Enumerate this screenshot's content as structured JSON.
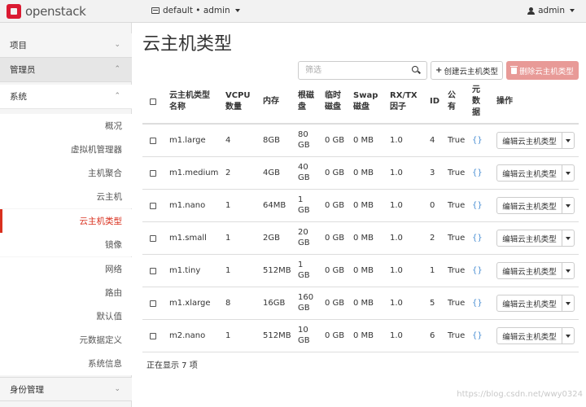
{
  "topbar": {
    "brand": "openstack",
    "project": "default • admin",
    "user": "admin"
  },
  "sidebar": {
    "sections": [
      {
        "label": "项目",
        "chevron": "⌄"
      },
      {
        "label": "管理员",
        "chevron": "⌃"
      }
    ],
    "system_label": "系统",
    "system_chevron": "⌃",
    "items": [
      {
        "label": "概况"
      },
      {
        "label": "虚拟机管理器"
      },
      {
        "label": "主机聚合"
      },
      {
        "label": "云主机"
      },
      {
        "label": "云主机类型"
      },
      {
        "label": "镜像"
      },
      {
        "label": "网络"
      },
      {
        "label": "路由"
      },
      {
        "label": "默认值"
      },
      {
        "label": "元数据定义"
      },
      {
        "label": "系统信息"
      }
    ],
    "identity_label": "身份管理",
    "identity_chevron": "⌄"
  },
  "main": {
    "title": "云主机类型",
    "filter_placeholder": "筛选",
    "create_label": "创建云主机类型",
    "delete_label": "删除云主机类型",
    "columns": {
      "name_l1": "云主机类型",
      "name_l2": "名称",
      "vcpu_l1": "VCPU",
      "vcpu_l2": "数量",
      "ram": "内存",
      "root_l1": "根磁",
      "root_l2": "盘",
      "eph_l1": "临时",
      "eph_l2": "磁盘",
      "swap_l1": "Swap",
      "swap_l2": "磁盘",
      "rxtx_l1": "RX/TX",
      "rxtx_l2": "因子",
      "id": "ID",
      "public_l1": "公",
      "public_l2": "有",
      "meta_l1": "元",
      "meta_l2": "数",
      "meta_l3": "据",
      "actions": "操作"
    },
    "rows": [
      {
        "name": "m1.large",
        "vcpu": "4",
        "ram": "8GB",
        "root1": "80",
        "root2": "GB",
        "eph": "0 GB",
        "swap": "0 MB",
        "rxtx": "1.0",
        "id": "4",
        "public": "True",
        "meta": "{}",
        "action": "编辑云主机类型"
      },
      {
        "name": "m1.medium",
        "vcpu": "2",
        "ram": "4GB",
        "root1": "40",
        "root2": "GB",
        "eph": "0 GB",
        "swap": "0 MB",
        "rxtx": "1.0",
        "id": "3",
        "public": "True",
        "meta": "{}",
        "action": "编辑云主机类型"
      },
      {
        "name": "m1.nano",
        "vcpu": "1",
        "ram": "64MB",
        "root1": "1",
        "root2": "GB",
        "eph": "0 GB",
        "swap": "0 MB",
        "rxtx": "1.0",
        "id": "0",
        "public": "True",
        "meta": "{}",
        "action": "编辑云主机类型"
      },
      {
        "name": "m1.small",
        "vcpu": "1",
        "ram": "2GB",
        "root1": "20",
        "root2": "GB",
        "eph": "0 GB",
        "swap": "0 MB",
        "rxtx": "1.0",
        "id": "2",
        "public": "True",
        "meta": "{}",
        "action": "编辑云主机类型"
      },
      {
        "name": "m1.tiny",
        "vcpu": "1",
        "ram": "512MB",
        "root1": "1",
        "root2": "GB",
        "eph": "0 GB",
        "swap": "0 MB",
        "rxtx": "1.0",
        "id": "1",
        "public": "True",
        "meta": "{}",
        "action": "编辑云主机类型"
      },
      {
        "name": "m1.xlarge",
        "vcpu": "8",
        "ram": "16GB",
        "root1": "160",
        "root2": "GB",
        "eph": "0 GB",
        "swap": "0 MB",
        "rxtx": "1.0",
        "id": "5",
        "public": "True",
        "meta": "{}",
        "action": "编辑云主机类型"
      },
      {
        "name": "m2.nano",
        "vcpu": "1",
        "ram": "512MB",
        "root1": "10",
        "root2": "GB",
        "eph": "0 GB",
        "swap": "0 MB",
        "rxtx": "1.0",
        "id": "6",
        "public": "True",
        "meta": "{}",
        "action": "编辑云主机类型"
      }
    ],
    "count_text": "正在显示 7 项"
  },
  "watermark": "https://blog.csdn.net/wwy0324",
  "colors": {
    "accent": "#d9301e",
    "delete_button": "#e89a97",
    "meta_link": "#4a8fd3"
  }
}
